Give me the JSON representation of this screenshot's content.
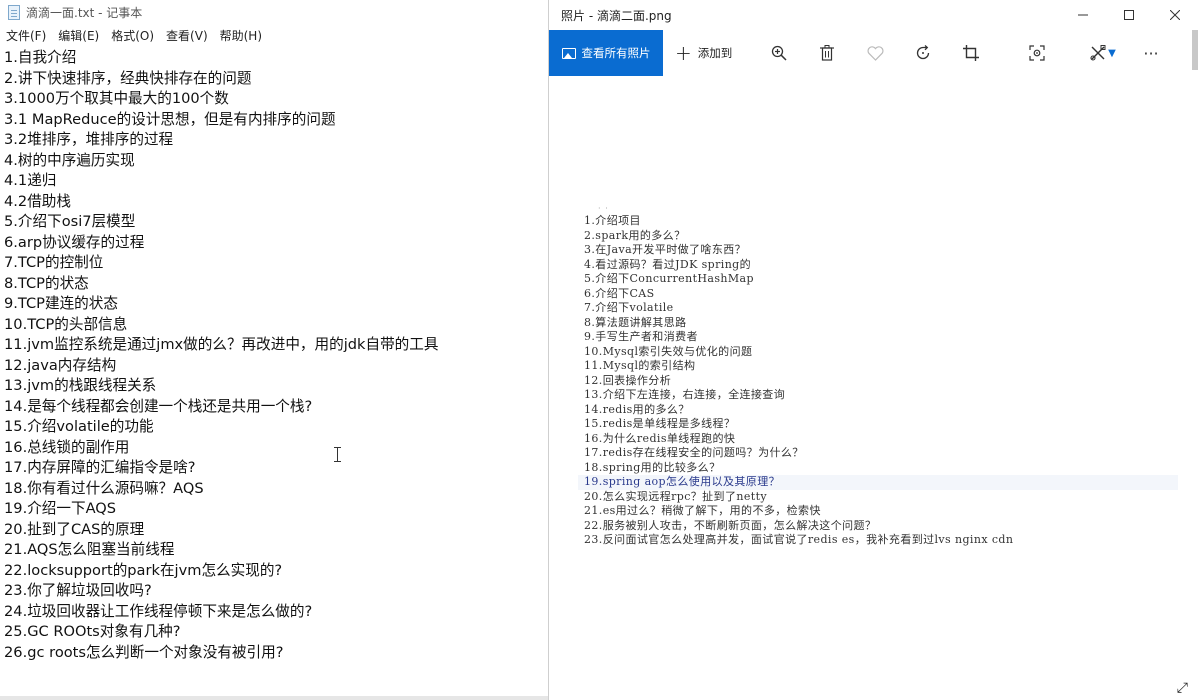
{
  "notepad": {
    "title": "滴滴一面.txt - 记事本",
    "menu": [
      "文件(F)",
      "编辑(E)",
      "格式(O)",
      "查看(V)",
      "帮助(H)"
    ],
    "lines": [
      "1.自我介绍",
      "2.讲下快速排序，经典快排存在的问题",
      "3.1000万个取其中最大的100个数",
      "3.1 MapReduce的设计思想，但是有内排序的问题",
      "3.2堆排序，堆排序的过程",
      "4.树的中序遍历实现",
      "4.1递归",
      "4.2借助栈",
      "5.介绍下osi7层模型",
      "6.arp协议缓存的过程",
      "7.TCP的控制位",
      "8.TCP的状态",
      "9.TCP建连的状态",
      "10.TCP的头部信息",
      "11.jvm监控系统是通过jmx做的么？再改进中，用的jdk自带的工具",
      "12.java内存结构",
      "13.jvm的栈跟线程关系",
      "14.是每个线程都会创建一个栈还是共用一个栈?",
      "15.介绍volatile的功能",
      "16.总线锁的副作用",
      "17.内存屏障的汇编指令是啥?",
      "18.你有看过什么源码嘛？AQS",
      "19.介绍一下AQS",
      "20.扯到了CAS的原理",
      "21.AQS怎么阻塞当前线程",
      "22.locksupport的park在jvm怎么实现的?",
      "23.你了解垃圾回收吗?",
      "24.垃圾回收器让工作线程停顿下来是怎么做的?",
      "25.GC ROOts对象有几种?",
      "26.gc roots怎么判断一个对象没有被引用?"
    ]
  },
  "photos": {
    "title": "照片 - 滴滴二面.png",
    "toolbar": {
      "view_all": "查看所有照片",
      "add_to": "添加到"
    },
    "image_lines": [
      "1.介绍项目",
      "2.spark用的多么？",
      "3.在Java开发平时做了啥东西？",
      "4.看过源码？看过JDK spring的",
      "5.介绍下ConcurrentHashMap",
      "6.介绍下CAS",
      "7.介绍下volatile",
      "8.算法题讲解其思路",
      "9.手写生产者和消费者",
      "10.Mysql索引失效与优化的问题",
      "11.Mysql的索引结构",
      "12.回表操作分析",
      "13.介绍下左连接，右连接，全连接查询",
      "14.redis用的多么？",
      "15.redis是单线程是多线程？",
      "16.为什么redis单线程跑的快",
      "17.redis存在线程安全的问题吗？为什么？",
      "18.spring用的比较多么？",
      "19.spring aop怎么使用以及其原理？",
      "20.怎么实现远程rpc？扯到了netty",
      "21.es用过么？稍微了解下，用的不多，检索快",
      "22.服务被别人攻击，不断刷新页面，怎么解决这个问题？",
      "23.反问面试官怎么处理高并发，面试官说了redis es，我补充看到过lvs nginx cdn"
    ],
    "highlighted_line_index": 18
  },
  "colors": {
    "accent": "#0a6cd1",
    "highlight_text": "#2a3a8c"
  }
}
